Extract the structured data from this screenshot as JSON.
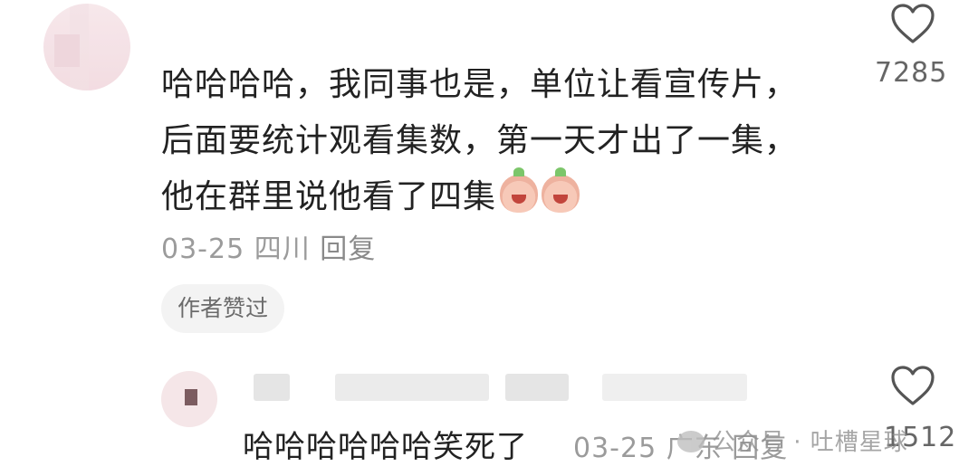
{
  "comments": [
    {
      "text": "哈哈哈哈，我同事也是，单位让看宣传片，\n后面要统计观看集数，第一天才出了一集，\n他在群里说他看了四集",
      "date": "03-25",
      "location": "四川",
      "reply_label": "回复",
      "author_badge": "作者赞过",
      "like_count": "7285",
      "emoji": "crying-laughing-emoji"
    },
    {
      "text": "哈哈哈哈哈哈笑死了",
      "date": "03-25",
      "location": "广东",
      "reply_label": "回复",
      "like_count": "1512"
    }
  ],
  "watermark": "公众号 · 吐槽星球",
  "icons": {
    "like": "heart-outline-icon"
  }
}
